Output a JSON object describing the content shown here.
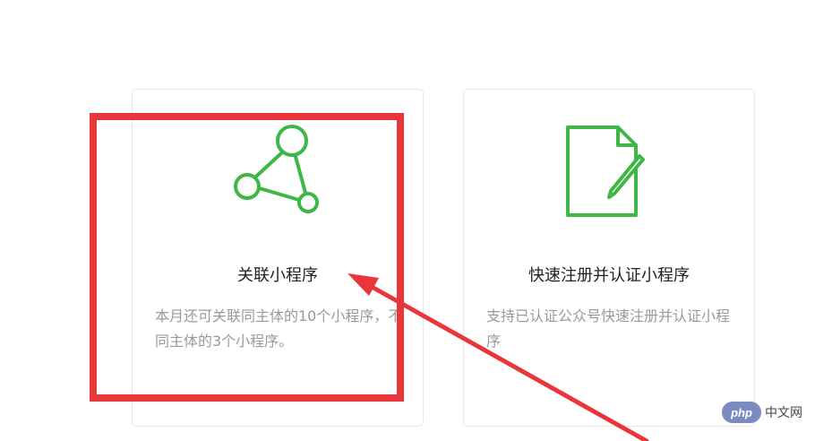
{
  "cards": [
    {
      "title": "关联小程序",
      "desc": "本月还可关联同主体的10个小程序，不同主体的3个小程序。",
      "icon": "network-nodes-icon",
      "icon_color": "#3db847"
    },
    {
      "title": "快速注册并认证小程序",
      "desc": "支持已认证公众号快速注册并认证小程序",
      "icon": "document-edit-icon",
      "icon_color": "#3db847"
    }
  ],
  "annotation": {
    "highlight_color": "#e8363a",
    "arrow_color": "#e8363a"
  },
  "watermark": {
    "logo_text": "php",
    "site_text": "中文网",
    "logo_color": "#7b8ac0"
  }
}
